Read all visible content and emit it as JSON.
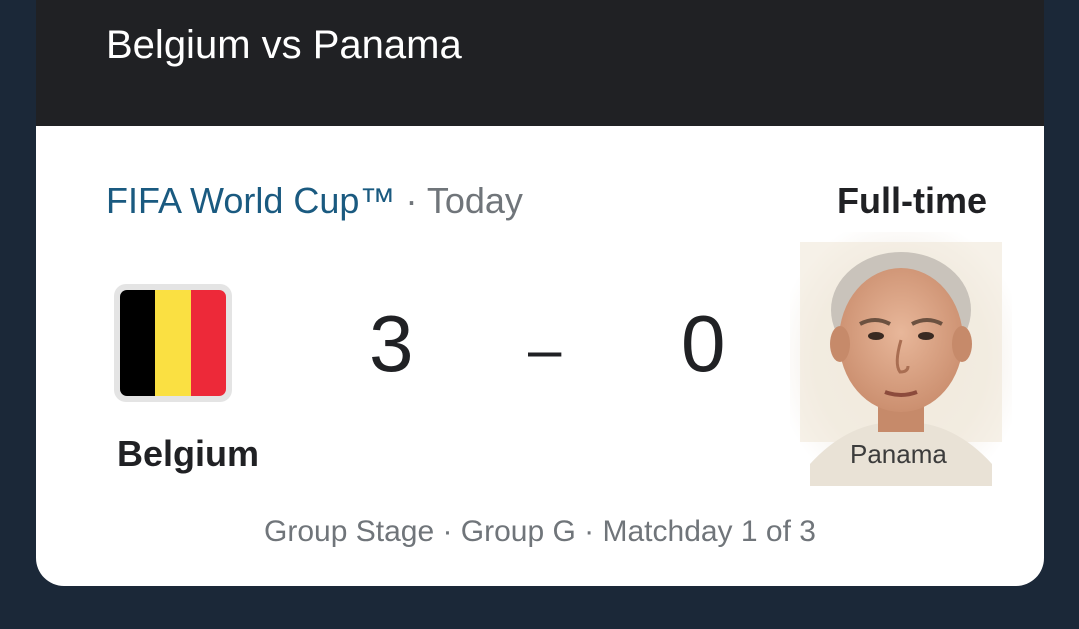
{
  "header": {
    "title": "Belgium vs Panama"
  },
  "match": {
    "competition": "FIFA World Cup™",
    "separator": "·",
    "date": "Today",
    "status": "Full-time",
    "home": {
      "name": "Belgium",
      "score": "3",
      "flag_colors": [
        "#000000",
        "#fae042",
        "#ed2939"
      ]
    },
    "score_separator": "–",
    "away": {
      "name": "Panama",
      "score": "0",
      "image": "man-portrait"
    },
    "stage_info": "Group Stage · Group G · Matchday 1 of 3"
  }
}
